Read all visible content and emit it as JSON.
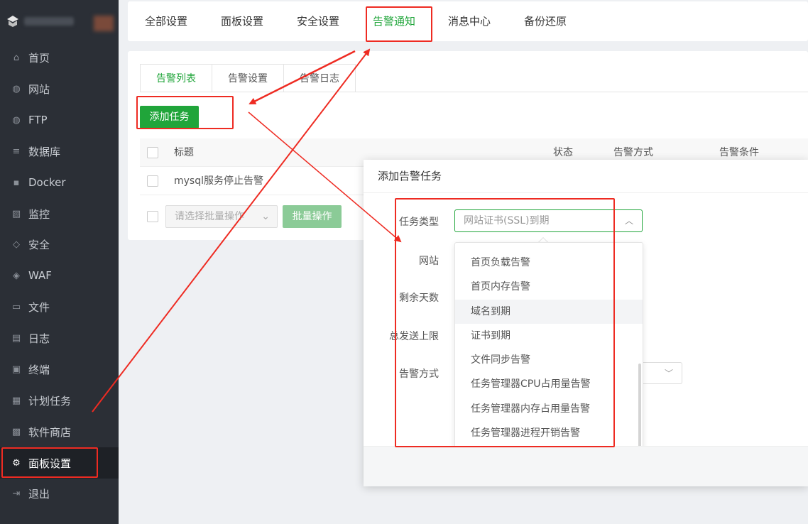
{
  "sidebar": {
    "items": [
      {
        "label": "首页",
        "icon": "home-icon",
        "glyph": "⌂"
      },
      {
        "label": "网站",
        "icon": "globe-icon",
        "glyph": "◍"
      },
      {
        "label": "FTP",
        "icon": "ftp-globe-icon",
        "glyph": "◍"
      },
      {
        "label": "数据库",
        "icon": "database-icon",
        "glyph": "≡"
      },
      {
        "label": "Docker",
        "icon": "docker-icon",
        "glyph": "▪"
      },
      {
        "label": "监控",
        "icon": "monitor-chart-icon",
        "glyph": "▨"
      },
      {
        "label": "安全",
        "icon": "shield-icon",
        "glyph": "◇"
      },
      {
        "label": "WAF",
        "icon": "waf-shield-icon",
        "glyph": "◈"
      },
      {
        "label": "文件",
        "icon": "folder-icon",
        "glyph": "▭"
      },
      {
        "label": "日志",
        "icon": "log-file-icon",
        "glyph": "▤"
      },
      {
        "label": "终端",
        "icon": "terminal-icon",
        "glyph": "▣"
      },
      {
        "label": "计划任务",
        "icon": "calendar-icon",
        "glyph": "▦"
      },
      {
        "label": "软件商店",
        "icon": "apps-grid-icon",
        "glyph": "▩"
      },
      {
        "label": "面板设置",
        "icon": "gear-icon",
        "glyph": "⚙"
      },
      {
        "label": "退出",
        "icon": "logout-icon",
        "glyph": "⇥"
      }
    ],
    "active_index": 13
  },
  "topnav": {
    "tabs": [
      "全部设置",
      "面板设置",
      "安全设置",
      "告警通知",
      "消息中心",
      "备份还原"
    ],
    "active_index": 3
  },
  "alerts": {
    "subtabs": [
      "告警列表",
      "告警设置",
      "告警日志"
    ],
    "add_button": "添加任务",
    "columns": {
      "title": "标题",
      "status": "状态",
      "method": "告警方式",
      "condition": "告警条件"
    },
    "rows": [
      {
        "title": "mysql服务停止告警"
      }
    ],
    "batch_placeholder": "请选择批量操作",
    "batch_button": "批量操作"
  },
  "modal": {
    "title": "添加告警任务",
    "labels": {
      "type": "任务类型",
      "site": "网站",
      "days": "剩余天数",
      "limit": "总发送上限",
      "method": "告警方式"
    },
    "type_value": "网站证书(SSL)到期",
    "options": [
      "首页负载告警",
      "首页内存告警",
      "域名到期",
      "证书到期",
      "文件同步告警",
      "任务管理器CPU占用量告警",
      "任务管理器内存占用量告警",
      "任务管理器进程开销告警"
    ],
    "hover_index": 2
  },
  "colors": {
    "accent": "#20a53a",
    "annotation": "#ee2b22",
    "sidebar_bg": "#2b2f36"
  }
}
